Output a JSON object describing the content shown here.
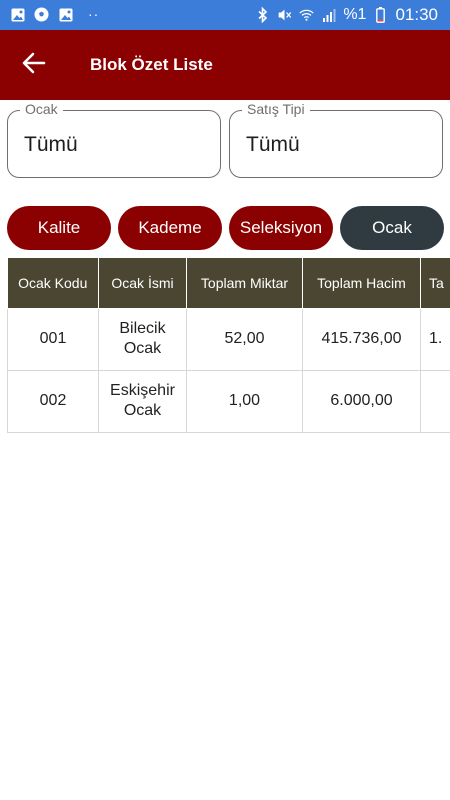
{
  "status_bar": {
    "icons_left": [
      "image-icon",
      "soccer-ball-icon",
      "image-icon"
    ],
    "dots": "··",
    "icons_right": [
      "bluetooth-icon",
      "mute-icon",
      "wifi-icon",
      "signal-icon",
      "battery-icon"
    ],
    "battery_percent": "%1",
    "time": "01:30",
    "bg_color": "#3b7dd8"
  },
  "app_bar": {
    "title": "Blok Özet Liste",
    "back_icon": "arrow-left-icon",
    "bg_color": "#8b0000"
  },
  "filters": {
    "ocak": {
      "label": "Ocak",
      "value": "Tümü"
    },
    "satis_tipi": {
      "label": "Satış Tipi",
      "value": "Tümü"
    }
  },
  "tabs": [
    {
      "label": "Kalite",
      "active": false
    },
    {
      "label": "Kademe",
      "active": false
    },
    {
      "label": "Seleksiyon",
      "active": false
    },
    {
      "label": "Ocak",
      "active": true
    }
  ],
  "colors": {
    "tab_inactive": "#8b0000",
    "tab_active": "#2f3b41",
    "table_header": "#4a4632"
  },
  "table": {
    "columns": [
      "Ocak Kodu",
      "Ocak İsmi",
      "Toplam Miktar",
      "Toplam Hacim",
      "Ta"
    ],
    "rows": [
      [
        "001",
        "Bilecik\nOcak",
        "52,00",
        "415.736,00",
        "1."
      ],
      [
        "002",
        "Eskişehir\nOcak",
        "1,00",
        "6.000,00",
        ""
      ]
    ]
  }
}
